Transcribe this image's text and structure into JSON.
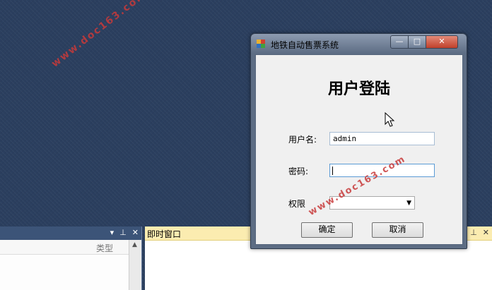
{
  "watermark": {
    "text": "www.doc163.com"
  },
  "left_panel": {
    "column_header": "类型",
    "icons": {
      "pin": "pin-icon",
      "close": "close-icon",
      "dropdown": "dropdown-icon"
    }
  },
  "immediate_window": {
    "title": "即时窗口"
  },
  "dialog": {
    "title": "地铁自动售票系统",
    "controls": {
      "minimize": "—",
      "maximize": "□",
      "close": "✕"
    },
    "heading": "用户登陆",
    "username_label": "用户名:",
    "username_value": "admin",
    "password_label": "密码:",
    "password_value": "",
    "role_label": "权限",
    "role_value": "",
    "ok_label": "确定",
    "cancel_label": "取消"
  }
}
